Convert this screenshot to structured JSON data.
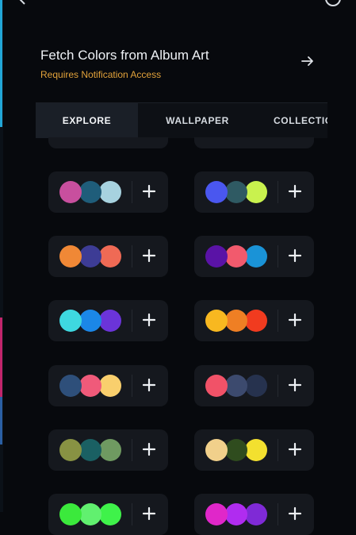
{
  "header": {
    "back_icon": "chevron-left-icon",
    "menu_icon": "circle-icon"
  },
  "fetch_section": {
    "title": "Fetch Colors from Album Art",
    "subtitle": "Requires Notification Access",
    "subtitle_color": "#e2a23a",
    "arrow_icon": "arrow-right-icon"
  },
  "tabs": [
    {
      "label": "EXPLORE",
      "active": true
    },
    {
      "label": "WALLPAPER",
      "active": false
    },
    {
      "label": "COLLECTIONS",
      "active": false
    }
  ],
  "palettes": [
    {
      "colors": [
        "#c84f9e",
        "#1f5d7a",
        "#a7d2df"
      ]
    },
    {
      "colors": [
        "#4a57ef",
        "#2f5a63",
        "#c9f24e"
      ]
    },
    {
      "colors": [
        "#f08836",
        "#3d3c95",
        "#ef6a55"
      ]
    },
    {
      "colors": [
        "#5a13a6",
        "#f25a6d",
        "#1a93d7"
      ]
    },
    {
      "colors": [
        "#3ed8e0",
        "#1b87e7",
        "#6b34d9"
      ]
    },
    {
      "colors": [
        "#f8b820",
        "#ef7f24",
        "#f13b1f"
      ]
    },
    {
      "colors": [
        "#2e4f7a",
        "#f05a7a",
        "#f9cf6d"
      ]
    },
    {
      "colors": [
        "#f15268",
        "#3c4a6e",
        "#26324e"
      ]
    },
    {
      "colors": [
        "#889243",
        "#1a6063",
        "#6f9a61"
      ]
    },
    {
      "colors": [
        "#f1d08b",
        "#2f4c1e",
        "#f3e02f"
      ]
    },
    {
      "colors": [
        "#3be93c",
        "#61f06f",
        "#3ff24a"
      ]
    },
    {
      "colors": [
        "#e027c9",
        "#b02cf0",
        "#7f2ad6"
      ]
    }
  ],
  "add_icon": "plus-icon",
  "accent_colors": {
    "background": "#07090d",
    "card": "#15181e",
    "tab_active": "#1a1f27"
  }
}
